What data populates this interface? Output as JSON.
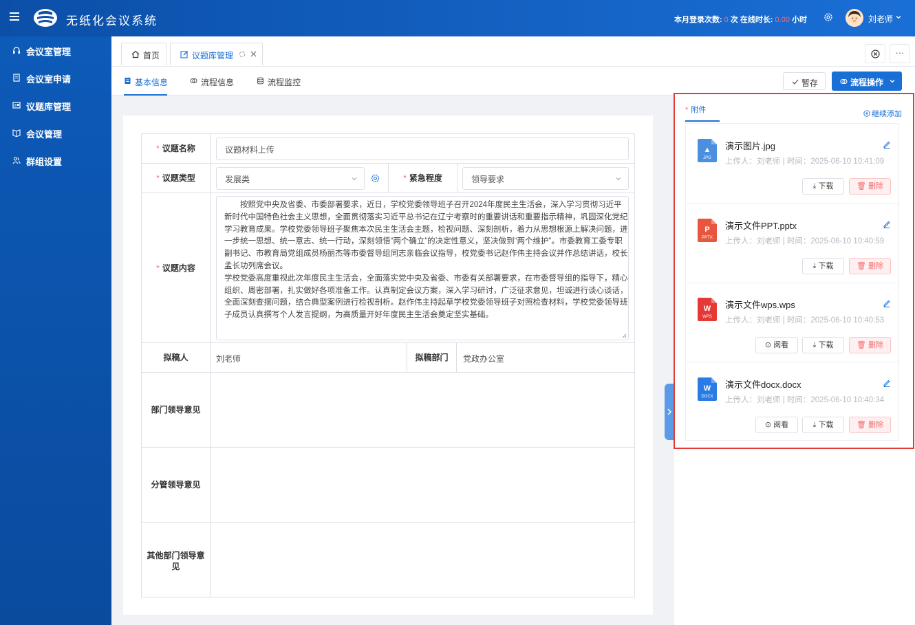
{
  "header": {
    "app_title": "无纸化会议系统",
    "login_count_label": "本月登录次数:",
    "login_count": "0",
    "login_count_unit": "次",
    "online_time_label": "在线时长:",
    "online_time": "0.00",
    "online_time_unit": "小时",
    "user_name": "刘老师"
  },
  "sidebar": {
    "items": [
      {
        "label": "会议室管理",
        "icon": "headset-icon"
      },
      {
        "label": "会议室申请",
        "icon": "document-icon"
      },
      {
        "label": "议题库管理",
        "icon": "id-card-icon"
      },
      {
        "label": "会议管理",
        "icon": "book-icon"
      },
      {
        "label": "群组设置",
        "icon": "group-icon"
      }
    ]
  },
  "tabs": [
    {
      "label": "首页",
      "icon": "home-icon",
      "active": false
    },
    {
      "label": "议题库管理",
      "icon": "edit-icon",
      "active": true
    }
  ],
  "subnav": {
    "tabs": [
      {
        "label": "基本信息",
        "active": true
      },
      {
        "label": "流程信息",
        "active": false
      },
      {
        "label": "流程监控",
        "active": false
      }
    ],
    "save_label": "暂存",
    "flow_label": "流程操作"
  },
  "form": {
    "title_label": "议题名称",
    "title_value": "议题材料上传",
    "type_label": "议题类型",
    "type_value": "发展类",
    "urgency_label": "紧急程度",
    "urgency_value": "领导要求",
    "content_label": "议题内容",
    "content_value": "按照党中央及省委、市委部署要求，近日，学校党委领导班子召开2024年度民主生活会，深入学习贯彻习近平新时代中国特色社会主义思想，全面贯彻落实习近平总书记在辽宁考察时的重要讲话和重要指示精神，巩固深化党纪学习教育成果。学校党委领导班子聚焦本次民主生活会主题，检视问题、深刻剖析，着力从思想根源上解决问题，进一步统一思想、统一意志、统一行动，深刻领悟“两个确立”的决定性意义，坚决做到“两个维护”。市委教育工委专职副书记、市教育局党组成员杨丽杰等市委督导组同志亲临会议指导，校党委书记赵作伟主持会议并作总结讲话，校长孟长功列席会议。\n学校党委高度重视此次年度民主生活会，全面落实党中央及省委、市委有关部署要求，在市委督导组的指导下，精心组织、周密部署，扎实做好各项准备工作。认真制定会议方案，深入学习研讨，广泛征求意见，坦诚进行谈心谈话，全面深刻查摆问题，结合典型案例进行检视剖析。赵作伟主持起草学校党委领导班子对照检查材料，学校党委领导班子成员认真撰写个人发言提纲，为高质量开好年度民主生活会奠定坚实基础。",
    "drafter_label": "拟稿人",
    "drafter_value": "刘老师",
    "dept_label": "拟稿部门",
    "dept_value": "党政办公室",
    "dept_leader_label": "部门领导意见",
    "charge_leader_label": "分管领导意见",
    "other_leader_label": "其他部门领导意见"
  },
  "attachments": {
    "tab_label": "附件",
    "add_label": "继续添加",
    "view_label": "阅看",
    "download_label": "下载",
    "delete_label": "删除",
    "items": [
      {
        "name": "演示图片.jpg",
        "meta": "上传人：刘老师 | 时间：2025-06-10 10:41:09",
        "type_tag": "JPG",
        "color": "#4a8fe0",
        "viewable": false
      },
      {
        "name": "演示文件PPT.pptx",
        "meta": "上传人：刘老师 | 时间：2025-06-10 10:40:59",
        "type_tag": "PPTX",
        "color": "#e8563f",
        "viewable": false
      },
      {
        "name": "演示文件wps.wps",
        "meta": "上传人：刘老师 | 时间：2025-06-10 10:40:53",
        "type_tag": "WPS",
        "color": "#e53935",
        "viewable": true
      },
      {
        "name": "演示文件docx.docx",
        "meta": "上传人：刘老师 | 时间：2025-06-10 10:40:34",
        "type_tag": "DOCX",
        "color": "#2b7be4",
        "viewable": true
      }
    ]
  },
  "colors": {
    "primary": "#1a6fd6",
    "header_dark": "#0b4fa8",
    "danger": "#f56c6c",
    "highlight_border": "#e53935"
  }
}
